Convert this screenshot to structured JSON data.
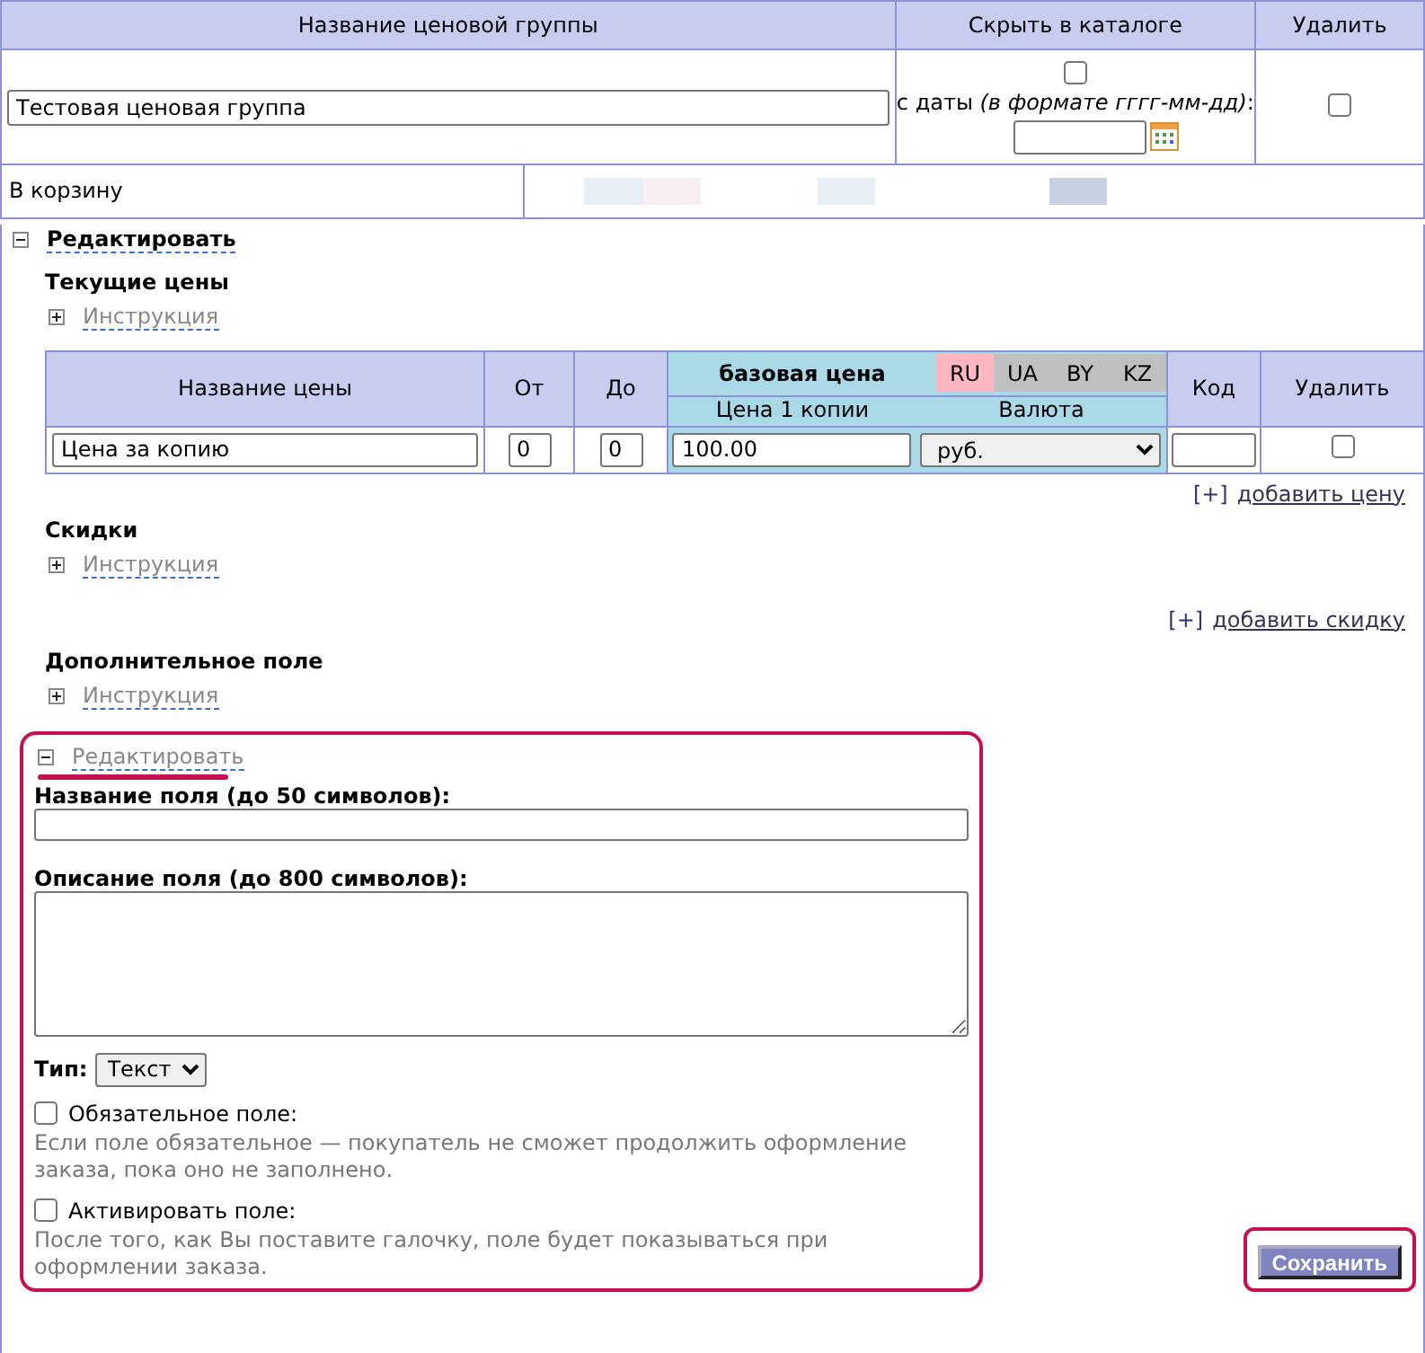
{
  "group_table": {
    "columns": [
      "Название ценовой группы",
      "Скрыть в каталоге",
      "Удалить"
    ],
    "name_value": "Тестовая ценовая группа",
    "hide_checked": false,
    "date_label": "с даты *(в формате гггг-мм-дд)*:",
    "delete_checked": false,
    "cart_label": "В корзину"
  },
  "edit_toggle": {
    "label": "Редактировать",
    "expanded": true
  },
  "current_prices": {
    "title": "Текущие цены",
    "instruction": {
      "label": "Инструкция",
      "expanded": false
    },
    "columns": [
      "Название цены",
      "От",
      "До"
    ],
    "base_price": "базовая цена",
    "currencies": [
      {
        "label": "RU",
        "selected": true
      },
      {
        "label": "UA",
        "selected": false
      },
      {
        "label": "BY",
        "selected": false
      },
      {
        "label": "KZ",
        "selected": false
      }
    ],
    "sub_columns": [
      "Цена 1 копии",
      "Валюта"
    ],
    "columns_end": [
      "Код",
      "Удалить"
    ],
    "rows": [
      {
        "name": "Цена за копию",
        "from": "0",
        "to": "0",
        "price": "100.00",
        "currency": "руб.",
        "delete_checked": false
      }
    ],
    "add_bracket": "[+]",
    "add_link": "добавить цену"
  },
  "discounts": {
    "title": "Скидки",
    "instruction": {
      "label": "Инструкция",
      "expanded": false
    },
    "add_bracket": "[+]",
    "add_link": "добавить скидку"
  },
  "extra_field": {
    "title": "Дополнительное поле",
    "instruction": {
      "label": "Инструкция",
      "expanded": false
    },
    "edit": {
      "label": "Редактировать",
      "expanded": true
    },
    "name_label": "Название поля (до 50 символов):",
    "desc_label": "Описание поля (до 800 символов):",
    "type_label": "Тип:",
    "type_value": "Текст",
    "options": [
      {
        "label": "Обязательное поле:",
        "checked": false,
        "note": "Если поле обязательное — покупатель не сможет продолжить оформление заказа, пока оно не заполнено."
      },
      {
        "label": "Активировать поле:",
        "checked": false,
        "note": "После того, как Вы поставите галочку, поле будет показываться при оформлении заказа."
      }
    ]
  },
  "save_button": "Сохранить"
}
